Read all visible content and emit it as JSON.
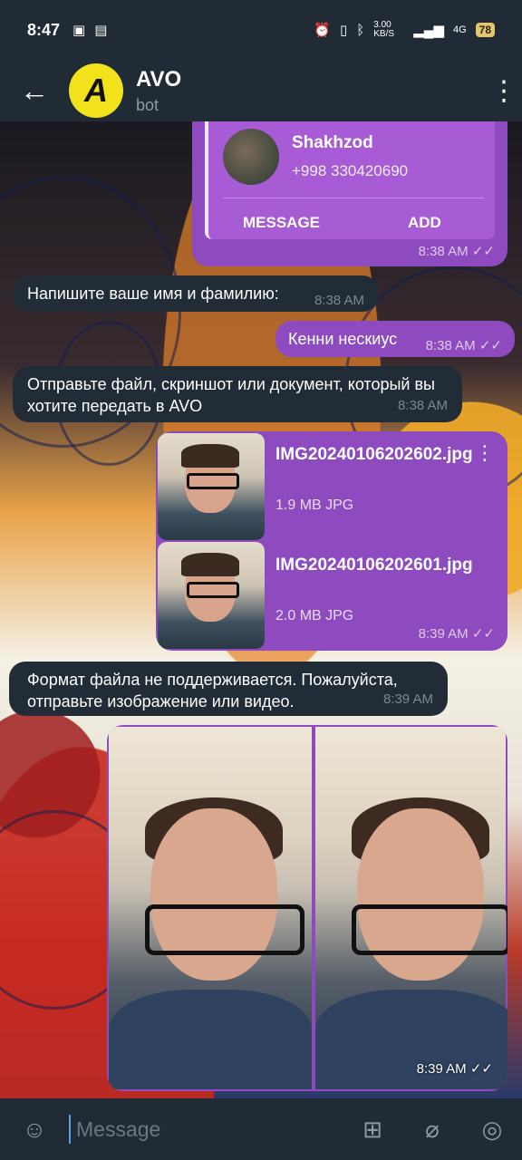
{
  "status_bar": {
    "time": "8:47",
    "network_speed": "3.00 KB/S",
    "network": "4G",
    "battery": "78"
  },
  "header": {
    "title": "AVO",
    "subtitle": "bot",
    "avatar_letter": "A",
    "avatar_color": "#f2e21c"
  },
  "messages": {
    "contact": {
      "name": "Shakhzod",
      "phone": "+998 330420690",
      "message_btn": "MESSAGE",
      "add_btn": "ADD",
      "time": "8:38 AM"
    },
    "m1": {
      "text": "Напишите ваше имя и фамилию:",
      "time": "8:38 AM"
    },
    "m2": {
      "text": "Кенни нескиус",
      "time": "8:38 AM"
    },
    "m3": {
      "text": "Отправьте файл, скриншот или документ, который вы хотите передать в AVO",
      "time": "8:38 AM"
    },
    "files": {
      "items": [
        {
          "name": "IMG20240106202602.jpg",
          "size": "1.9 MB JPG"
        },
        {
          "name": "IMG20240106202601.jpg",
          "size": "2.0 MB JPG"
        }
      ],
      "time": "8:39 AM"
    },
    "m4": {
      "text": "Формат файла не поддерживается. Пожалуйста, отправьте изображение или видео.",
      "time": "8:39 AM"
    },
    "photos": {
      "time": "8:39 AM"
    }
  },
  "input": {
    "placeholder": "Message"
  },
  "colors": {
    "outgoing": "#8e4bbf",
    "incoming": "#222c37",
    "header": "#212b36"
  }
}
